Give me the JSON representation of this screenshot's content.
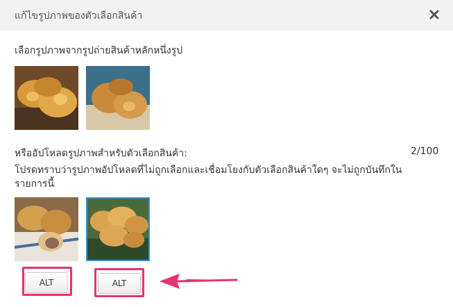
{
  "header": {
    "title": "แก้ไขรูปภาพของตัวเลือกสินค้า"
  },
  "icons": {
    "close": "close-icon"
  },
  "product_images": {
    "label": "เลือกรูปภาพจากรูปถ่ายสินค้าหลักหนึ่งรูป"
  },
  "upload": {
    "label": "หรืออัปโหลดรูปภาพสำหรับตัวเลือกสินค้า:",
    "count": "2/100",
    "note_line1": "โปรดทราบว่ารูปภาพอัปโหลดที่ไม่ถูกเลือกและเชื่อมโยงกับตัวเลือกสินค้าใดๆ จะไม่ถูกบันทึกใน",
    "note_line2": "รายการนี้",
    "alt_labels": [
      "ALT",
      "ALT"
    ]
  },
  "colors": {
    "highlight": "#e8326e",
    "selected_border": "#3d8fd1"
  }
}
